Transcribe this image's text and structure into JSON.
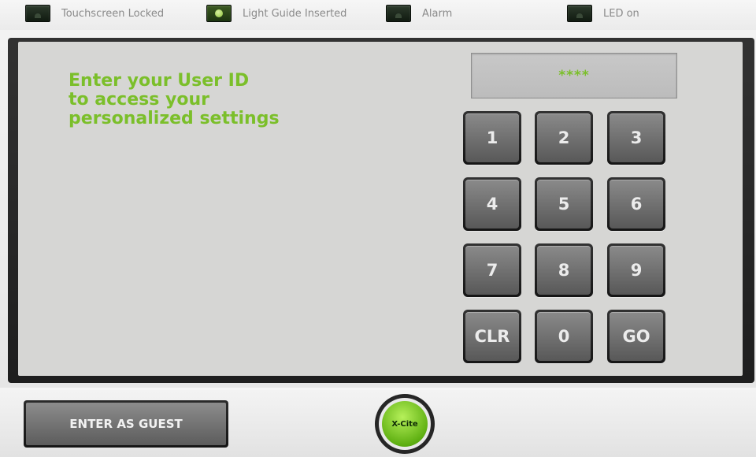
{
  "status_bar": {
    "items": [
      {
        "label": "Touchscreen Locked",
        "icon": "lock-indicator-icon",
        "active": false
      },
      {
        "label": "Light Guide Inserted",
        "icon": "lightbulb-indicator-icon",
        "active": true
      },
      {
        "label": "Alarm",
        "icon": "alarm-indicator-icon",
        "active": false
      },
      {
        "label": "LED on",
        "icon": "led-indicator-icon",
        "active": false
      }
    ]
  },
  "login": {
    "prompt": "Enter your User ID\nto access your\npersonalized settings",
    "entry_display": "****"
  },
  "keypad": {
    "keys": [
      "1",
      "2",
      "3",
      "4",
      "5",
      "6",
      "7",
      "8",
      "9",
      "CLR",
      "0",
      "GO"
    ]
  },
  "bottom_bar": {
    "guest_label": "ENTER AS GUEST",
    "logo_label": "X-Cite"
  },
  "colors": {
    "accent": "#7bbf2a",
    "panel_background": "#d6d6d4",
    "key_face": "#707070"
  }
}
